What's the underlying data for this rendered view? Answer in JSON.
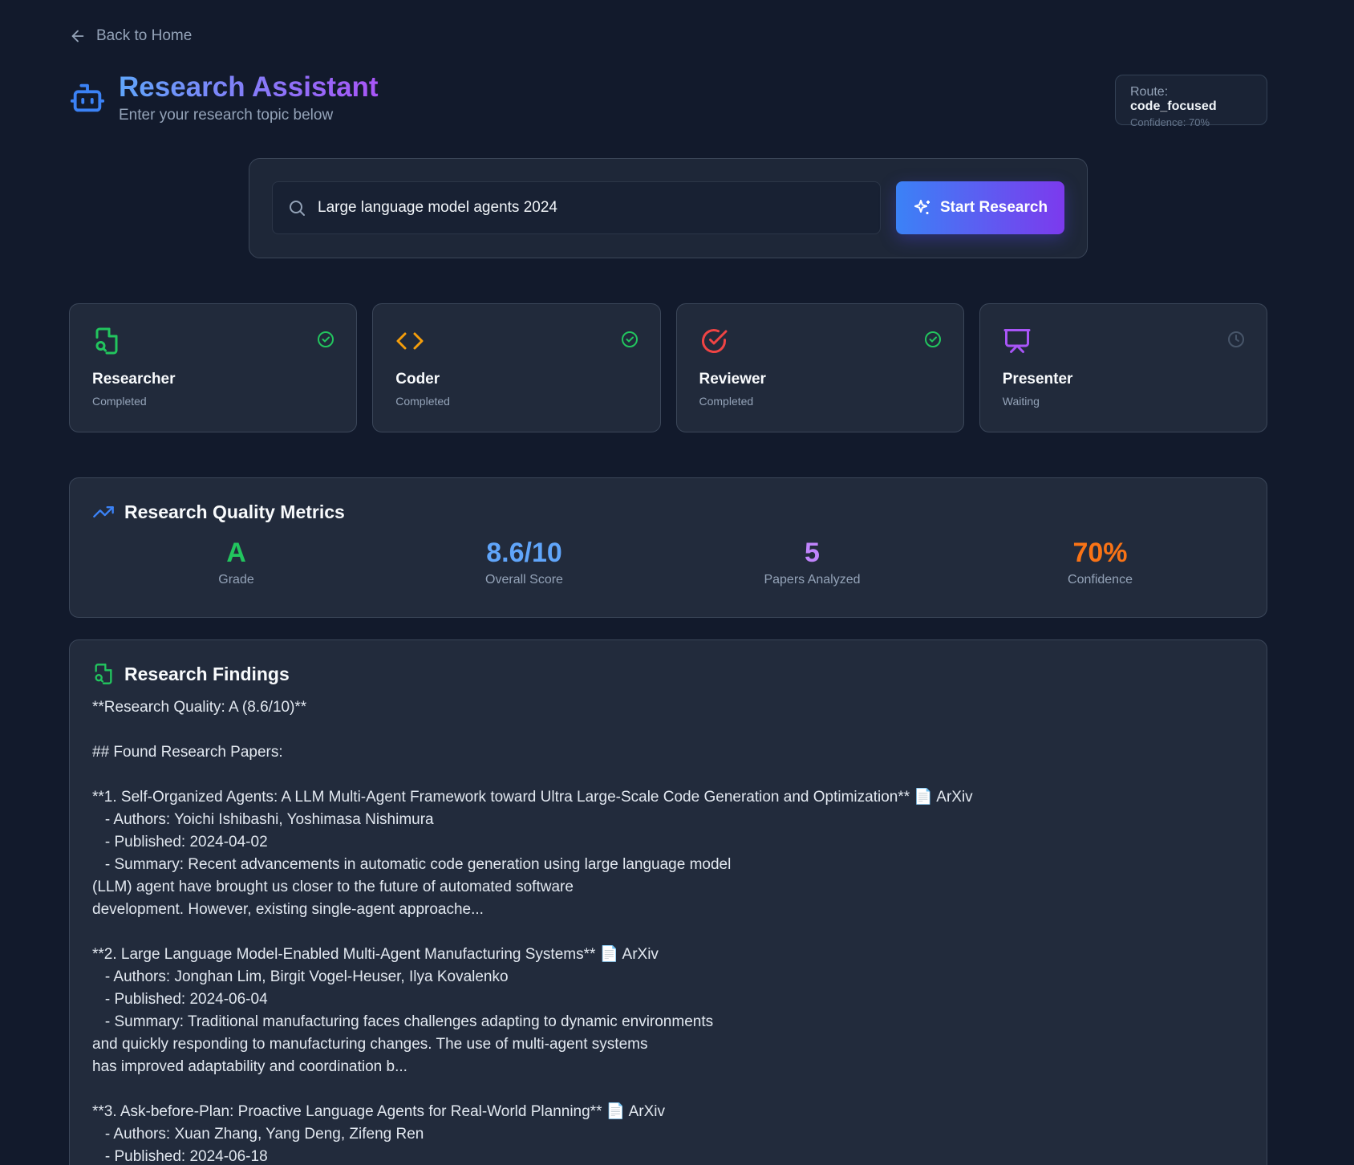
{
  "nav": {
    "back_label": "Back to Home"
  },
  "header": {
    "title": "Research Assistant",
    "subtitle": "Enter your research topic below",
    "icon": "bot-icon"
  },
  "route": {
    "label": "Route:",
    "value": "code_focused",
    "confidence": "Confidence: 70%"
  },
  "search": {
    "value": "Large language model agents 2024",
    "button_label": "Start Research"
  },
  "agents": [
    {
      "name": "Researcher",
      "status": "Completed",
      "icon": "file-search-icon",
      "color": "#22c55e",
      "done": true
    },
    {
      "name": "Coder",
      "status": "Completed",
      "icon": "code-icon",
      "color": "#f59e0b",
      "done": true
    },
    {
      "name": "Reviewer",
      "status": "Completed",
      "icon": "check-circle-icon",
      "color": "#ef4444",
      "done": true
    },
    {
      "name": "Presenter",
      "status": "Waiting",
      "icon": "presentation-icon",
      "color": "#a855f7",
      "done": false
    }
  ],
  "metrics": {
    "title": "Research Quality Metrics",
    "items": [
      {
        "value": "A",
        "label": "Grade",
        "color": "#22c55e"
      },
      {
        "value": "8.6/10",
        "label": "Overall Score",
        "color": "#60a5fa"
      },
      {
        "value": "5",
        "label": "Papers Analyzed",
        "color": "#c084fc"
      },
      {
        "value": "70%",
        "label": "Confidence",
        "color": "#f97316"
      }
    ]
  },
  "findings": {
    "title": "Research Findings",
    "body": "**Research Quality: A (8.6/10)**\n\n## Found Research Papers:\n\n**1. Self-Organized Agents: A LLM Multi-Agent Framework toward Ultra Large-Scale Code Generation and Optimization** 📄 ArXiv\n   - Authors: Yoichi Ishibashi, Yoshimasa Nishimura\n   - Published: 2024-04-02\n   - Summary: Recent advancements in automatic code generation using large language model\n(LLM) agent have brought us closer to the future of automated software\ndevelopment. However, existing single-agent approache...\n\n**2. Large Language Model-Enabled Multi-Agent Manufacturing Systems** 📄 ArXiv\n   - Authors: Jonghan Lim, Birgit Vogel-Heuser, Ilya Kovalenko\n   - Published: 2024-06-04\n   - Summary: Traditional manufacturing faces challenges adapting to dynamic environments\nand quickly responding to manufacturing changes. The use of multi-agent systems\nhas improved adaptability and coordination b...\n\n**3. Ask-before-Plan: Proactive Language Agents for Real-World Planning** 📄 ArXiv\n   - Authors: Xuan Zhang, Yang Deng, Zifeng Ren\n   - Published: 2024-06-18"
  }
}
